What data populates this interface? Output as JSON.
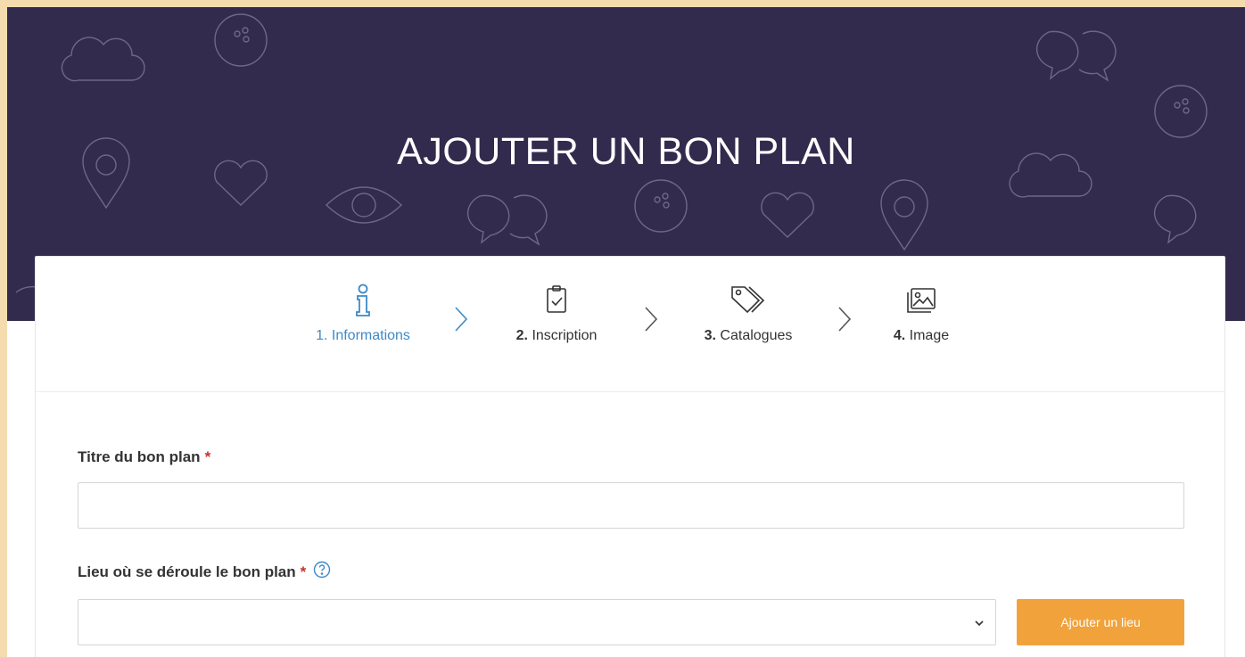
{
  "hero": {
    "title": "AJOUTER UN BON PLAN"
  },
  "steps": [
    {
      "number": "1.",
      "label": "Informations",
      "icon": "info-icon",
      "active": true
    },
    {
      "number": "2.",
      "label": "Inscription",
      "icon": "clipboard-check-icon",
      "active": false
    },
    {
      "number": "3.",
      "label": "Catalogues",
      "icon": "tags-icon",
      "active": false
    },
    {
      "number": "4.",
      "label": "Image",
      "icon": "images-icon",
      "active": false
    }
  ],
  "form": {
    "title_field": {
      "label": "Titre du bon plan",
      "required_mark": "*",
      "value": ""
    },
    "place_field": {
      "label": "Lieu où se déroule le bon plan",
      "required_mark": "*",
      "value": "",
      "help_icon": "help-circle-icon"
    },
    "add_place_button": "Ajouter un lieu"
  },
  "colors": {
    "hero_bg": "#332b4d",
    "accent_blue": "#3d8ac7",
    "button_orange": "#f2a23a",
    "required_red": "#c9302c",
    "outer_bg": "#f4dcae"
  }
}
